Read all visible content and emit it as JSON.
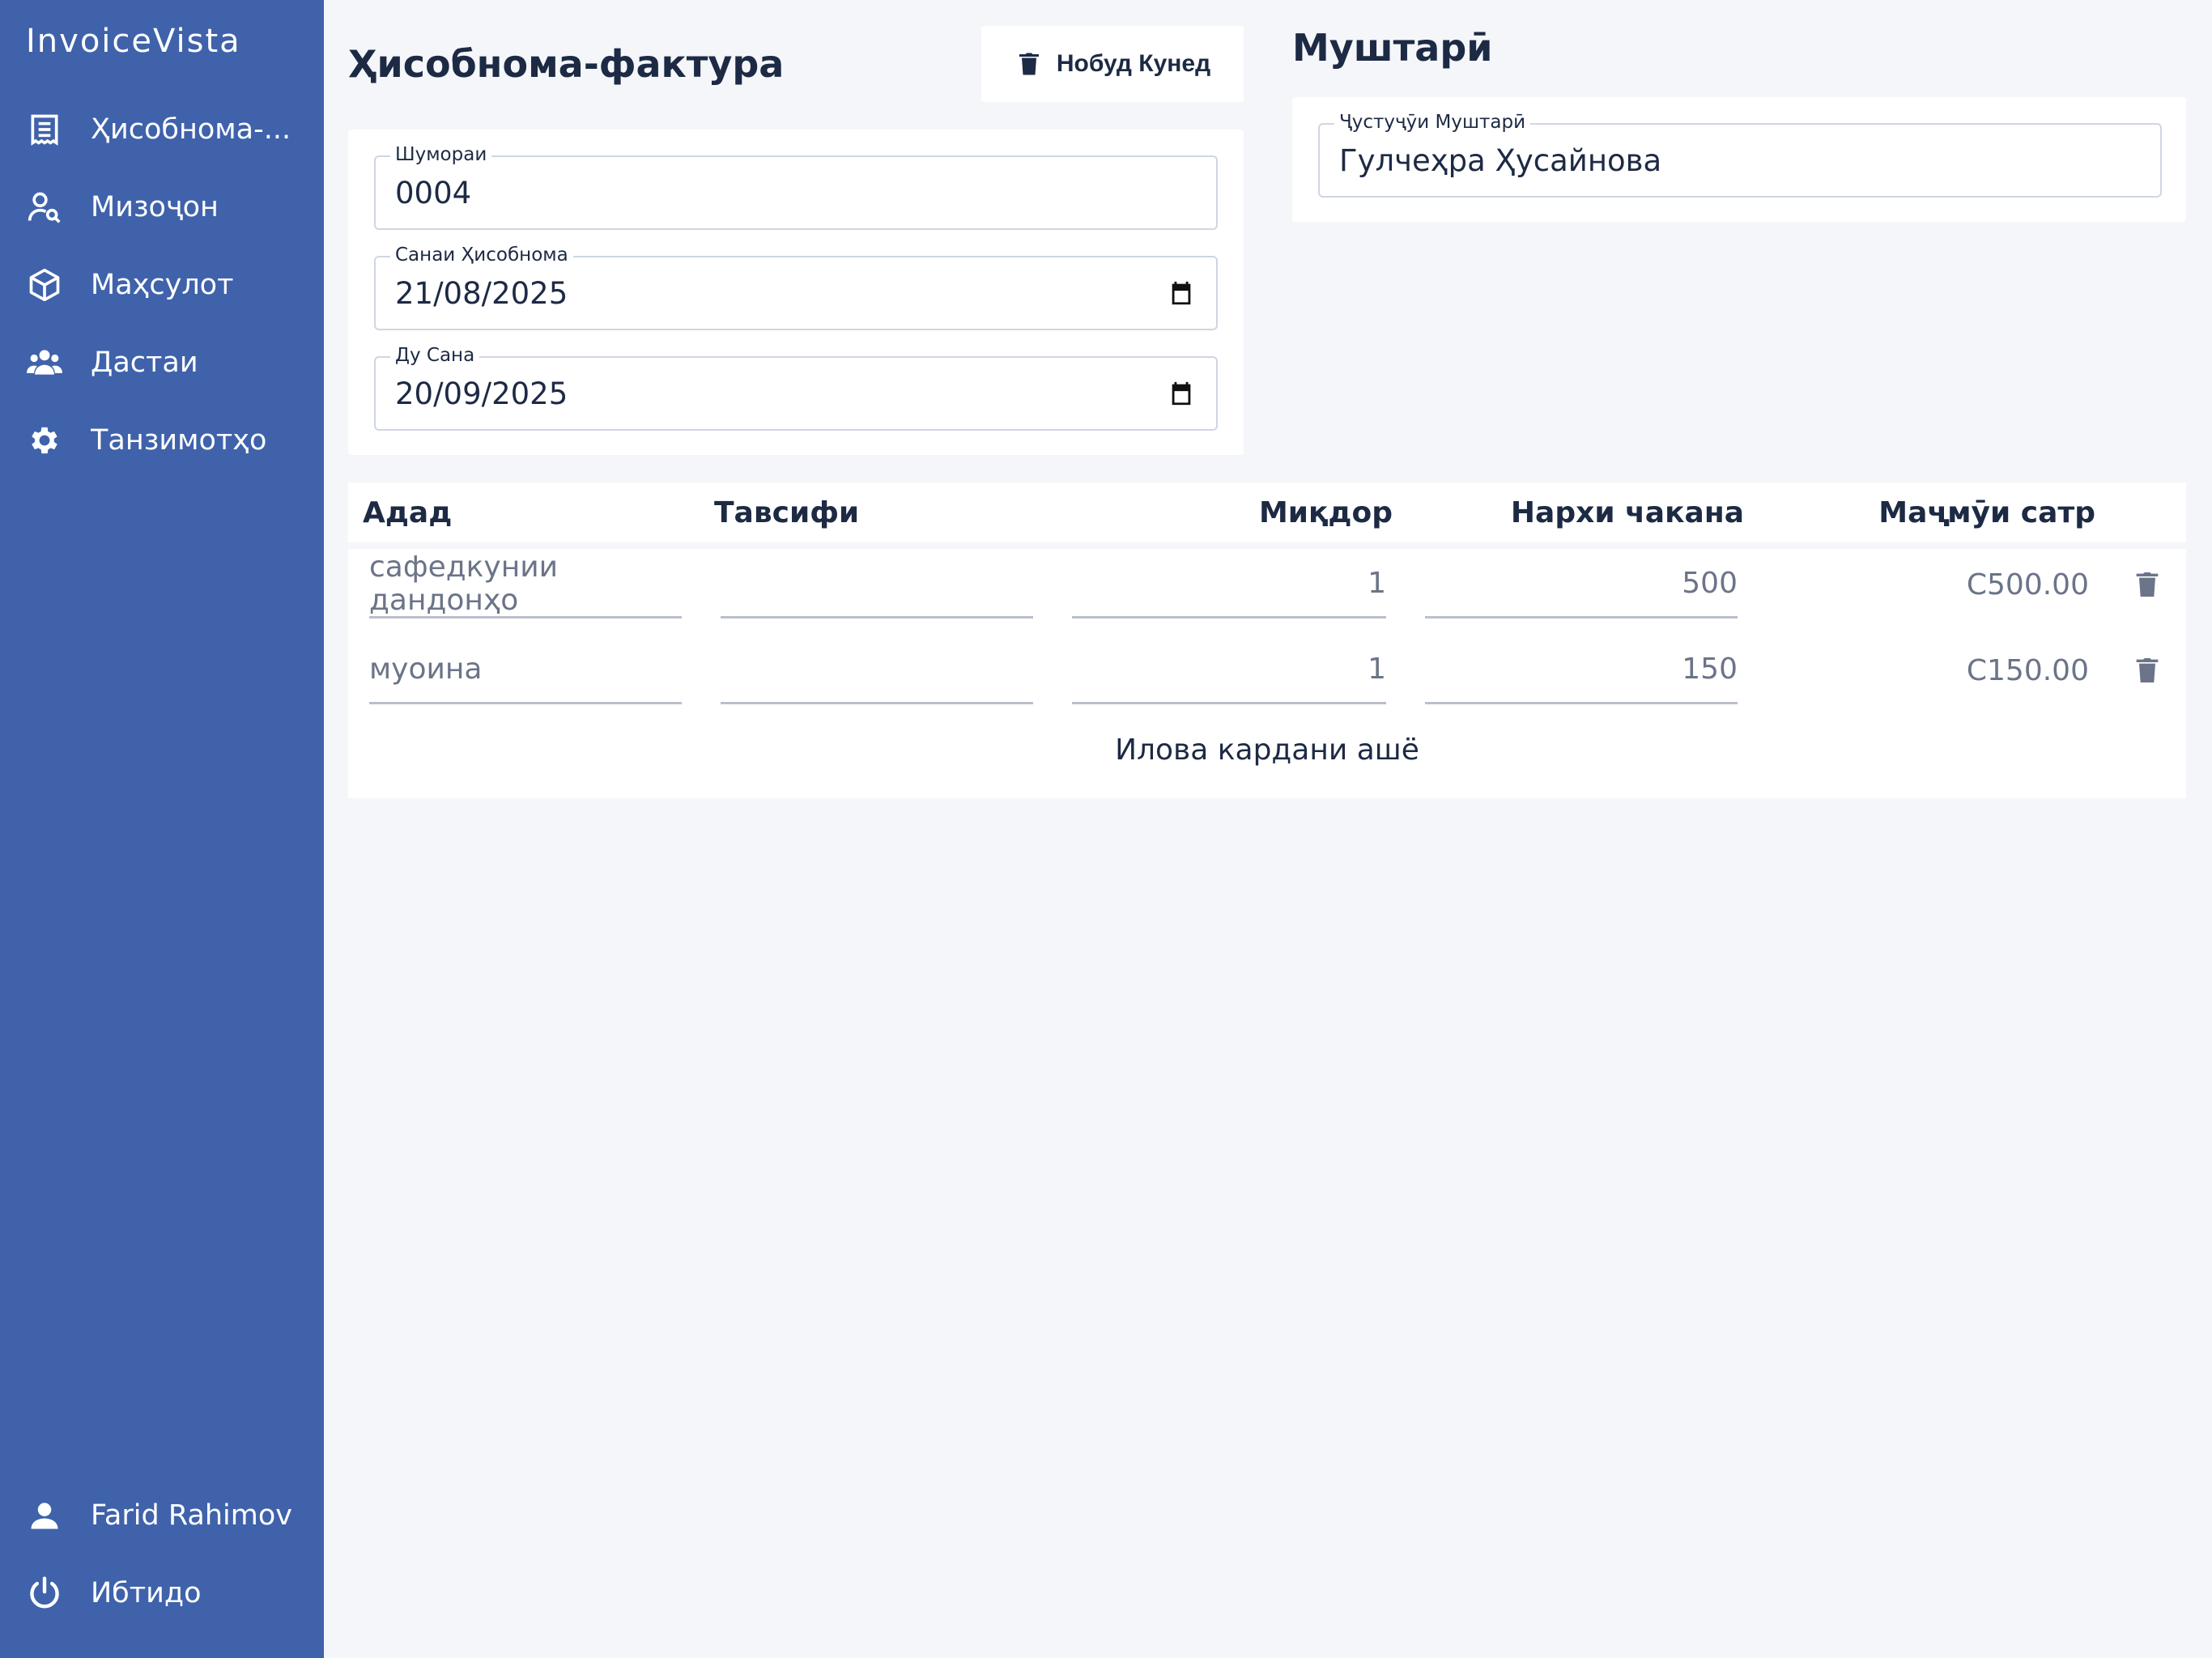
{
  "app": {
    "brand": "InvoiceVista"
  },
  "sidebar": {
    "items": [
      {
        "label": "Ҳисобнома-...",
        "icon": "receipt-icon"
      },
      {
        "label": "Мизоҷон",
        "icon": "user-search-icon"
      },
      {
        "label": "Маҳсулот",
        "icon": "cube-icon"
      },
      {
        "label": "Дастаи",
        "icon": "team-icon"
      },
      {
        "label": "Танзимотҳо",
        "icon": "gear-icon"
      }
    ],
    "user": {
      "label": "Farid Rahimov",
      "icon": "person-icon"
    },
    "logout": {
      "label": "Ибтидо",
      "icon": "power-icon"
    }
  },
  "invoice": {
    "title": "Ҳисобнома-фактура",
    "delete_label": "Нобуд Кунед",
    "number": {
      "label": "Шумораи",
      "value": "0004"
    },
    "invoice_date": {
      "label": "Санаи Ҳисобнома",
      "value": "21/08/2025"
    },
    "due_date": {
      "label": "Ду Сана",
      "value": "20/09/2025"
    }
  },
  "customer": {
    "title": "Муштарӣ",
    "search": {
      "label": "Ҷустуҷӯи Муштарӣ",
      "value": "Гулчеҳра Ҳусайнова"
    }
  },
  "table": {
    "headers": [
      "Адад",
      "Тавсифи",
      "Миқдор",
      "Нархи чакана",
      "Маҷмӯи сатр"
    ],
    "rows": [
      {
        "item": "сафедкунии дандонҳо",
        "description": "",
        "quantity": "1",
        "price": "500",
        "total": "C500.00"
      },
      {
        "item": "муоина",
        "description": "",
        "quantity": "1",
        "price": "150",
        "total": "C150.00"
      }
    ],
    "add_item_label": "Илова кардани ашё"
  },
  "colors": {
    "sidebar": "#3f62ab",
    "background": "#f4f6fa",
    "text": "#1d2a44",
    "muted": "#6b7488"
  }
}
